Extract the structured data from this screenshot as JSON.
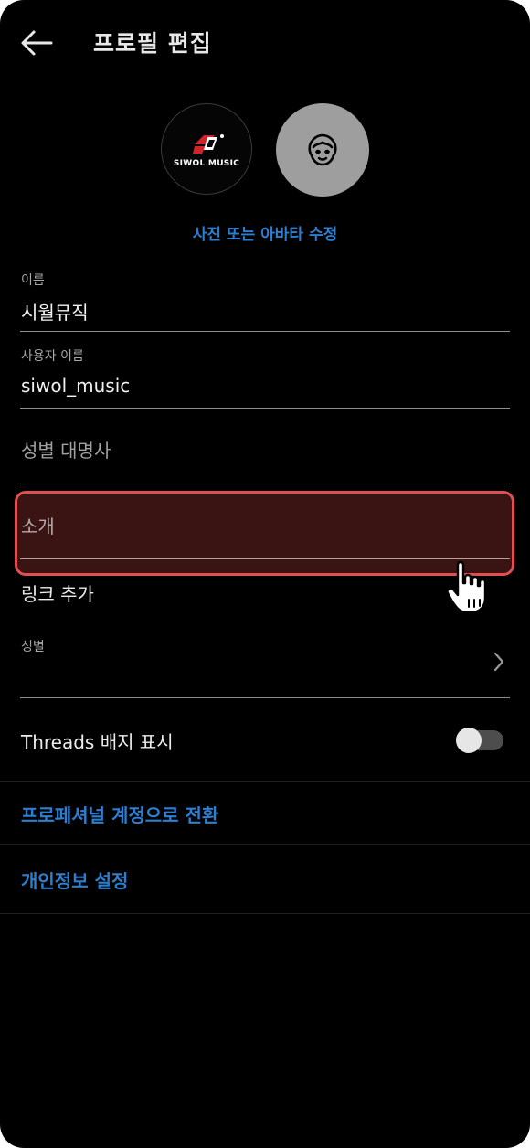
{
  "header": {
    "title": "프로필 편집",
    "back_icon": "arrow-left-icon"
  },
  "avatars": {
    "logo_text": "SIWOL MUSIC",
    "avatar_icon": "avatar-face-icon"
  },
  "edit_photo_label": "사진 또는 아바타 수정",
  "fields": {
    "name": {
      "label": "이름",
      "value": "시월뮤직"
    },
    "username": {
      "label": "사용자 이름",
      "value": "siwol_music"
    },
    "pronouns": {
      "placeholder": "성별 대명사"
    },
    "bio": {
      "placeholder": "소개"
    },
    "links": {
      "label": "링크 추가"
    },
    "gender": {
      "label": "성별",
      "value": ""
    }
  },
  "threads": {
    "label": "Threads 배지 표시",
    "toggle_on": false
  },
  "links": {
    "professional": "프로페셔널 계정으로 전환",
    "privacy": "개인정보 설정"
  },
  "colors": {
    "background": "#000000",
    "accent_link": "#2c7fd0",
    "highlight_border": "#e04f52",
    "highlight_fill": "#3a1313"
  }
}
